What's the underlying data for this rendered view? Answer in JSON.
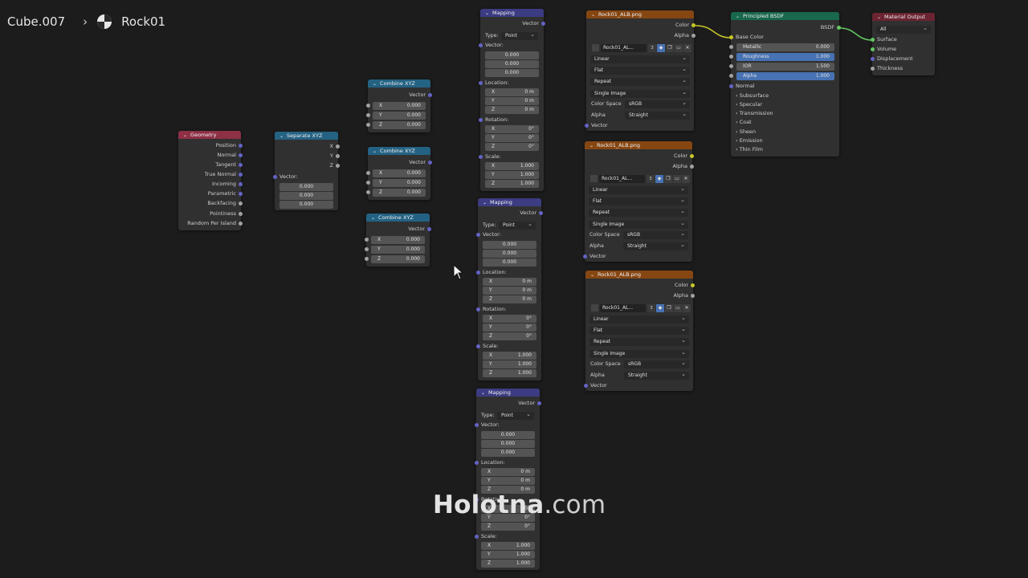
{
  "breadcrumb": {
    "object": "Cube.007",
    "material": "Rock01"
  },
  "geometry": {
    "title": "Geometry",
    "outputs": [
      "Position",
      "Normal",
      "Tangent",
      "True Normal",
      "Incoming",
      "Parametric",
      "Backfacing",
      "Pointiness",
      "Random Per Island"
    ]
  },
  "separate": {
    "title": "Separate XYZ",
    "outputs": [
      "X",
      "Y",
      "Z"
    ],
    "input": "Vector:",
    "values": [
      "0.000",
      "0.000",
      "0.000"
    ]
  },
  "combine": [
    {
      "title": "Combine XYZ",
      "output": "Vector",
      "fields": [
        {
          "l": "X",
          "v": "0.000"
        },
        {
          "l": "Y",
          "v": "0.000"
        },
        {
          "l": "Z",
          "v": "0.000"
        }
      ]
    },
    {
      "title": "Combine XYZ",
      "output": "Vector",
      "fields": [
        {
          "l": "X",
          "v": "0.000"
        },
        {
          "l": "Y",
          "v": "0.000"
        },
        {
          "l": "Z",
          "v": "0.000"
        }
      ]
    },
    {
      "title": "Combine XYZ",
      "output": "Vector",
      "fields": [
        {
          "l": "X",
          "v": "0.000"
        },
        {
          "l": "Y",
          "v": "0.000"
        },
        {
          "l": "Z",
          "v": "0.000"
        }
      ]
    }
  ],
  "mapping": [
    {
      "title": "Mapping",
      "output": "Vector",
      "type_label": "Type:",
      "type_value": "Point",
      "vector_label": "Vector:",
      "vector": [
        "0.000",
        "0.000",
        "0.000"
      ],
      "location_label": "Location:",
      "location": [
        {
          "l": "X",
          "v": "0 m"
        },
        {
          "l": "Y",
          "v": "0 m"
        },
        {
          "l": "Z",
          "v": "0 m"
        }
      ],
      "rotation_label": "Rotation:",
      "rotation": [
        {
          "l": "X",
          "v": "0°"
        },
        {
          "l": "Y",
          "v": "0°"
        },
        {
          "l": "Z",
          "v": "0°"
        }
      ],
      "scale_label": "Scale:",
      "scale": [
        {
          "l": "X",
          "v": "1.000"
        },
        {
          "l": "Y",
          "v": "1.000"
        },
        {
          "l": "Z",
          "v": "1.000"
        }
      ]
    },
    {
      "title": "Mapping",
      "output": "Vector",
      "type_label": "Type:",
      "type_value": "Point",
      "vector_label": "Vector:",
      "vector": [
        "0.000",
        "0.000",
        "0.000"
      ],
      "location_label": "Location:",
      "location": [
        {
          "l": "X",
          "v": "0 m"
        },
        {
          "l": "Y",
          "v": "0 m"
        },
        {
          "l": "Z",
          "v": "0 m"
        }
      ],
      "rotation_label": "Rotation:",
      "rotation": [
        {
          "l": "X",
          "v": "0°"
        },
        {
          "l": "Y",
          "v": "0°"
        },
        {
          "l": "Z",
          "v": "0°"
        }
      ],
      "scale_label": "Scale:",
      "scale": [
        {
          "l": "X",
          "v": "1.000"
        },
        {
          "l": "Y",
          "v": "1.000"
        },
        {
          "l": "Z",
          "v": "1.000"
        }
      ]
    },
    {
      "title": "Mapping",
      "output": "Vector",
      "type_label": "Type:",
      "type_value": "Point",
      "vector_label": "Vector:",
      "vector": [
        "0.000",
        "0.000",
        "0.000"
      ],
      "location_label": "Location:",
      "location": [
        {
          "l": "X",
          "v": "0 m"
        },
        {
          "l": "Y",
          "v": "0 m"
        },
        {
          "l": "Z",
          "v": "0 m"
        }
      ],
      "rotation_label": "Rotation:",
      "rotation": [
        {
          "l": "X",
          "v": "0°"
        },
        {
          "l": "Y",
          "v": "0°"
        },
        {
          "l": "Z",
          "v": "0°"
        }
      ],
      "scale_label": "Scale:",
      "scale": [
        {
          "l": "X",
          "v": "1.000"
        },
        {
          "l": "Y",
          "v": "1.000"
        },
        {
          "l": "Z",
          "v": "1.000"
        }
      ]
    }
  ],
  "image_textures": [
    {
      "title": "Rock01_ALB.png",
      "outputs": [
        "Color",
        "Alpha"
      ],
      "image_name": "Rock01_AL...",
      "users": "3",
      "interpolation": "Linear",
      "projection": "Flat",
      "extension": "Repeat",
      "source": "Single Image",
      "color_space_label": "Color Space",
      "color_space": "sRGB",
      "alpha_label": "Alpha",
      "alpha": "Straight",
      "input": "Vector"
    },
    {
      "title": "Rock01_ALB.png",
      "outputs": [
        "Color",
        "Alpha"
      ],
      "image_name": "Rock01_AL...",
      "users": "3",
      "interpolation": "Linear",
      "projection": "Flat",
      "extension": "Repeat",
      "source": "Single Image",
      "color_space_label": "Color Space",
      "color_space": "sRGB",
      "alpha_label": "Alpha",
      "alpha": "Straight",
      "input": "Vector"
    },
    {
      "title": "Rock01_ALB.png",
      "outputs": [
        "Color",
        "Alpha"
      ],
      "image_name": "Rock01_AL...",
      "users": "3",
      "interpolation": "Linear",
      "projection": "Flat",
      "extension": "Repeat",
      "source": "Single Image",
      "color_space_label": "Color Space",
      "color_space": "sRGB",
      "alpha_label": "Alpha",
      "alpha": "Straight",
      "input": "Vector"
    }
  ],
  "bsdf": {
    "title": "Principled BSDF",
    "output": "BSDF",
    "base_color": "Base Color",
    "fields": [
      {
        "l": "Metallic",
        "v": "0.000"
      },
      {
        "l": "Roughness",
        "v": "1.000"
      },
      {
        "l": "IOR",
        "v": "1.500"
      },
      {
        "l": "Alpha",
        "v": "1.000"
      }
    ],
    "normal": "Normal",
    "panels": [
      "Subsurface",
      "Specular",
      "Transmission",
      "Coat",
      "Sheen",
      "Emission",
      "Thin Film"
    ]
  },
  "output": {
    "title": "Material Output",
    "target": "All",
    "inputs": [
      "Surface",
      "Volume",
      "Displacement",
      "Thickness"
    ]
  },
  "watermark": {
    "brand": "Holotna",
    "tld": ".com"
  },
  "colors": {
    "background": "#1c1c1c",
    "node_body": "#303030",
    "vector_socket": "#6363c7",
    "color_socket": "#c7c729",
    "shader_socket": "#63c763"
  }
}
